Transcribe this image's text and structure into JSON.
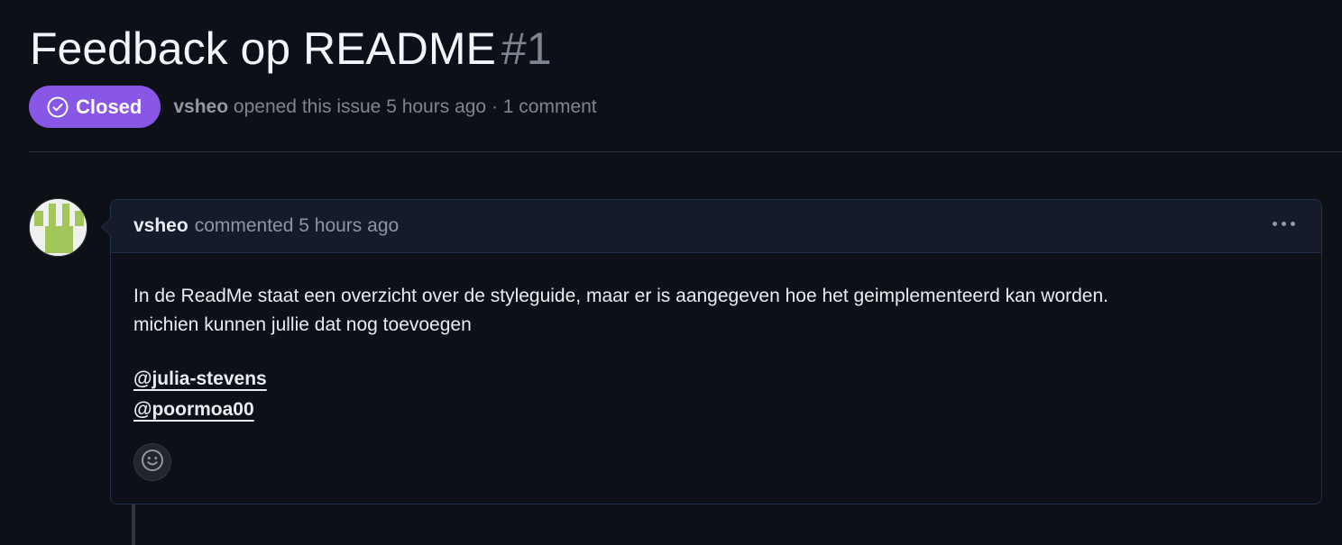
{
  "issue": {
    "title": "Feedback op README",
    "number": "#1",
    "state": "Closed",
    "author": "vsheo",
    "opened_text": "opened this issue 5 hours ago · 1 comment"
  },
  "comment": {
    "author": "vsheo",
    "meta": "commented 5 hours ago",
    "body_lines": [
      "In de ReadMe staat een overzicht over de styleguide, maar er is aangegeven hoe het geimplementeerd kan worden.",
      "michien kunnen jullie dat nog toevoegen"
    ],
    "mentions": [
      "@julia-stevens",
      "@poormoa00"
    ]
  },
  "icons": {
    "state": "check-circle-icon",
    "menu": "kebab-horizontal-icon",
    "reaction": "smiley-icon"
  },
  "colors": {
    "closed_badge": "#8957e5",
    "background": "#0d1117",
    "comment_header": "#151b2b",
    "avatar_accent": "#a3c65a"
  }
}
